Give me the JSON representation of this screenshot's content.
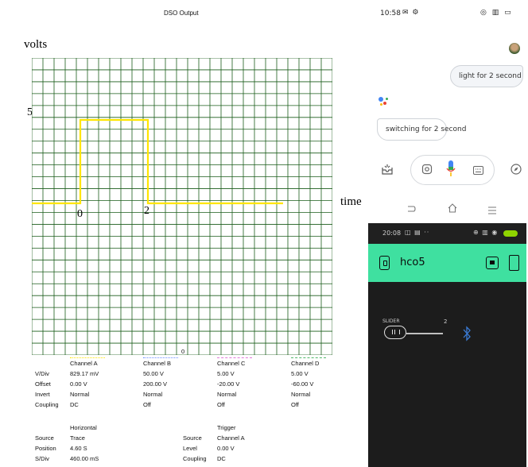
{
  "scope": {
    "window_title": "DSO Output",
    "ylabel": "volts",
    "xlabel": "time",
    "y_tick": "5",
    "x_tick_0": "0",
    "x_tick_2": "2",
    "bottom_zero": "0",
    "colors": {
      "grid": "#1a5c1a",
      "trace": "#ffe600",
      "channel_b": "#6a8cff",
      "channel_c": "#e07ad8",
      "channel_d": "#52b86a"
    }
  },
  "chart_data": {
    "type": "line",
    "title": "",
    "xlabel": "time",
    "ylabel": "volts",
    "grid": true,
    "series": [
      {
        "x": [
          -2,
          0,
          0,
          2,
          2,
          6
        ],
        "y": [
          0,
          0,
          5,
          5,
          0,
          0
        ]
      }
    ]
  },
  "channels": {
    "headers": [
      "Channel A",
      "Channel B",
      "Channel C",
      "Channel D"
    ],
    "rows": [
      {
        "label": "V/Div",
        "values": [
          "829.17 mV",
          "50.00 V",
          "5.00 V",
          "5.00 V"
        ]
      },
      {
        "label": "Offset",
        "values": [
          "0.00 V",
          "200.00 V",
          "-20.00 V",
          "-60.00 V"
        ]
      },
      {
        "label": "Invert",
        "values": [
          "Normal",
          "Normal",
          "Normal",
          "Normal"
        ]
      },
      {
        "label": "Coupling",
        "values": [
          "DC",
          "Off",
          "Off",
          "Off"
        ]
      }
    ]
  },
  "horizontal": {
    "title": "Horizontal",
    "rows": [
      {
        "label": "Source",
        "value": "Trace"
      },
      {
        "label": "Position",
        "value": "4.60 S"
      },
      {
        "label": "S/Div",
        "value": "460.00 mS"
      }
    ]
  },
  "trigger": {
    "title": "Trigger",
    "rows": [
      {
        "label": "Source",
        "value": "Channel A"
      },
      {
        "label": "Level",
        "value": "0.00 V"
      },
      {
        "label": "Coupling",
        "value": "DC"
      }
    ]
  },
  "assistant": {
    "status_time": "10:58",
    "user_message": "light for 2 second",
    "reply": "switching for 2 second",
    "icons": [
      "avatar",
      "assistant-dots",
      "inbox-icon",
      "lens-icon",
      "mic-icon",
      "keyboard-icon",
      "compass-icon",
      "back-icon",
      "home-icon",
      "menu-icon"
    ]
  },
  "app": {
    "status_time": "20:08",
    "title": "hco5",
    "slider_label": "SLIDER",
    "slider_value": "2",
    "slider_level": 0
  }
}
